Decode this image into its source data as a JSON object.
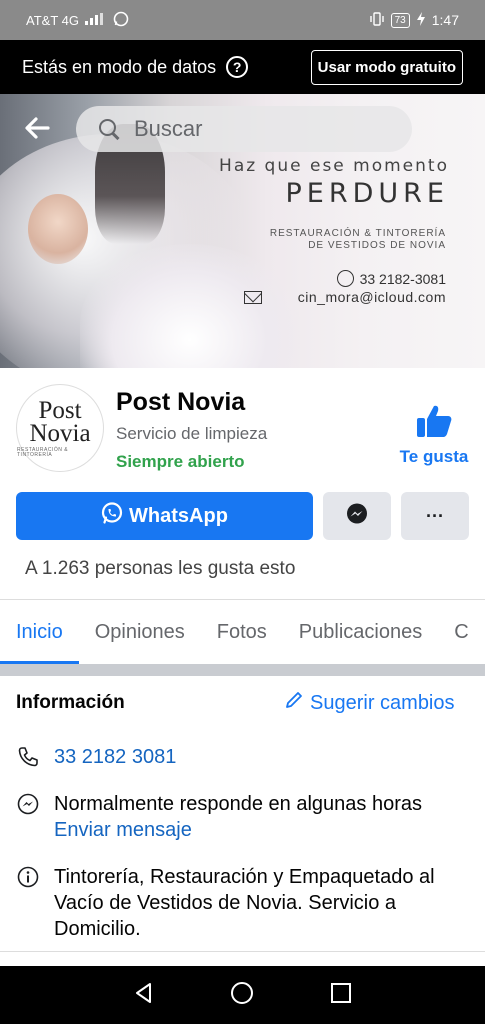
{
  "status_bar": {
    "carrier": "AT&T 4G",
    "battery": "73",
    "time": "1:47"
  },
  "data_banner": {
    "text": "Estás en modo de datos",
    "help_glyph": "?",
    "free_mode_label": "Usar modo gratuito"
  },
  "cover": {
    "search_placeholder": "Buscar",
    "headline_line1": "Haz que ese momento",
    "headline_line2": "PERDURE",
    "subline1": "RESTAURACIÓN & TINTORERÍA",
    "subline2": "DE VESTIDOS DE NOVIA",
    "phone": "33 2182-3081",
    "email": "cin_mora@icloud.com"
  },
  "profile": {
    "avatar_line1": "Post",
    "avatar_line2": "Novia",
    "avatar_line3": "RESTAURACIÓN & TINTORERÍA",
    "name": "Post Novia",
    "category": "Servicio de limpieza",
    "hours": "Siempre abierto",
    "like_label": "Te gusta"
  },
  "actions": {
    "whatsapp_label": "WhatsApp",
    "more_glyph": "···"
  },
  "likes_text": "A 1.263 personas les gusta esto",
  "tabs": [
    {
      "label": "Inicio"
    },
    {
      "label": "Opiniones"
    },
    {
      "label": "Fotos"
    },
    {
      "label": "Publicaciones"
    },
    {
      "label": "C"
    }
  ],
  "info": {
    "title": "Información",
    "suggest_label": "Sugerir cambios",
    "phone": "33 2182 3081",
    "response_text": "Normalmente responde en algunas horas",
    "send_message": "Enviar mensaje",
    "description": "Tintorería, Restauración y Empaquetado al Vacío de Vestidos de Novia. Servicio a Domicilio."
  },
  "colors": {
    "accent": "#1877f2",
    "open_green": "#31a24c",
    "button_gray": "#e4e6eb"
  },
  "icons": [
    "back-arrow-icon",
    "search-icon",
    "help-icon",
    "thumbs-up-icon",
    "whatsapp-icon",
    "messenger-icon",
    "more-icon",
    "pencil-icon",
    "phone-icon",
    "messenger-outline-icon",
    "info-icon",
    "nav-back-icon",
    "nav-home-icon",
    "nav-recents-icon"
  ]
}
